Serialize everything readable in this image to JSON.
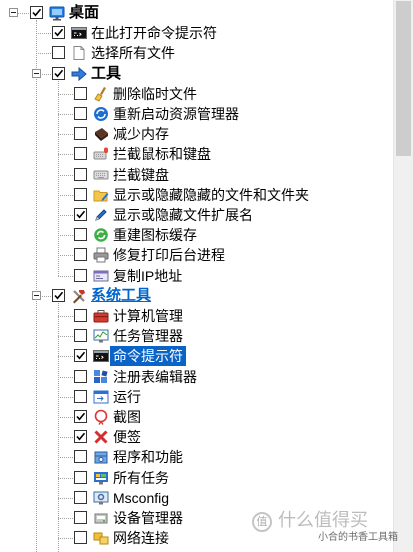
{
  "tree": {
    "rows": [
      {
        "label": "桌面",
        "level": 0,
        "checked": true,
        "expanded": true,
        "icon": "desktop-icon",
        "bold": true
      },
      {
        "label": "在此打开命令提示符",
        "level": 1,
        "checked": true,
        "icon": "command-prompt-icon"
      },
      {
        "label": "选择所有文件",
        "level": 1,
        "checked": false,
        "icon": "file-select-icon"
      },
      {
        "label": "工具",
        "level": 1,
        "checked": true,
        "expanded": true,
        "icon": "arrow-icon",
        "bold": true
      },
      {
        "label": "删除临时文件",
        "level": 2,
        "checked": false,
        "icon": "broom-icon"
      },
      {
        "label": "重新启动资源管理器",
        "level": 2,
        "checked": false,
        "icon": "restart-explorer-icon"
      },
      {
        "label": "减少内存",
        "level": 2,
        "checked": false,
        "icon": "memory-icon"
      },
      {
        "label": "拦截鼠标和键盘",
        "level": 2,
        "checked": false,
        "icon": "keyboard-mouse-icon"
      },
      {
        "label": "拦截键盘",
        "level": 2,
        "checked": false,
        "icon": "keyboard-icon"
      },
      {
        "label": "显示或隐藏隐藏的文件和文件夹",
        "level": 2,
        "checked": false,
        "icon": "hidden-files-icon"
      },
      {
        "label": "显示或隐藏文件扩展名",
        "level": 2,
        "checked": true,
        "icon": "file-extension-icon"
      },
      {
        "label": "重建图标缓存",
        "level": 2,
        "checked": false,
        "icon": "rebuild-cache-icon"
      },
      {
        "label": "修复打印后台进程",
        "level": 2,
        "checked": false,
        "icon": "printer-icon"
      },
      {
        "label": "复制IP地址",
        "level": 2,
        "checked": false,
        "icon": "ip-address-icon"
      },
      {
        "label": "系统工具",
        "level": 1,
        "checked": true,
        "expanded": true,
        "icon": "tools-icon",
        "bold": true,
        "hot": true
      },
      {
        "label": "计算机管理",
        "level": 2,
        "checked": false,
        "icon": "computer-management-icon"
      },
      {
        "label": "任务管理器",
        "level": 2,
        "checked": false,
        "icon": "task-manager-icon"
      },
      {
        "label": "命令提示符",
        "level": 2,
        "checked": true,
        "icon": "command-prompt-icon",
        "selected": true
      },
      {
        "label": "注册表编辑器",
        "level": 2,
        "checked": false,
        "icon": "registry-editor-icon"
      },
      {
        "label": "运行",
        "level": 2,
        "checked": false,
        "icon": "run-icon"
      },
      {
        "label": "截图",
        "level": 2,
        "checked": true,
        "icon": "snipping-tool-icon"
      },
      {
        "label": "便签",
        "level": 2,
        "checked": true,
        "icon": "sticky-notes-icon"
      },
      {
        "label": "程序和功能",
        "level": 2,
        "checked": false,
        "icon": "programs-icon"
      },
      {
        "label": "所有任务",
        "level": 2,
        "checked": false,
        "icon": "all-tasks-icon"
      },
      {
        "label": "Msconfig",
        "level": 2,
        "checked": false,
        "icon": "msconfig-icon"
      },
      {
        "label": "设备管理器",
        "level": 2,
        "checked": false,
        "icon": "device-manager-icon"
      },
      {
        "label": "网络连接",
        "level": 2,
        "checked": false,
        "icon": "network-icon"
      }
    ]
  },
  "scrollbar": {
    "position_fraction": 0,
    "visible_fraction": 0.28
  },
  "colors": {
    "selection": "#0a64c8",
    "hot_link": "#0066cc",
    "tree_line": "#a0a0a0",
    "checkbox_border": "#333333"
  },
  "watermark": {
    "logo": "值",
    "brand": "什么值得买",
    "caption": "小合的书香工具箱"
  }
}
